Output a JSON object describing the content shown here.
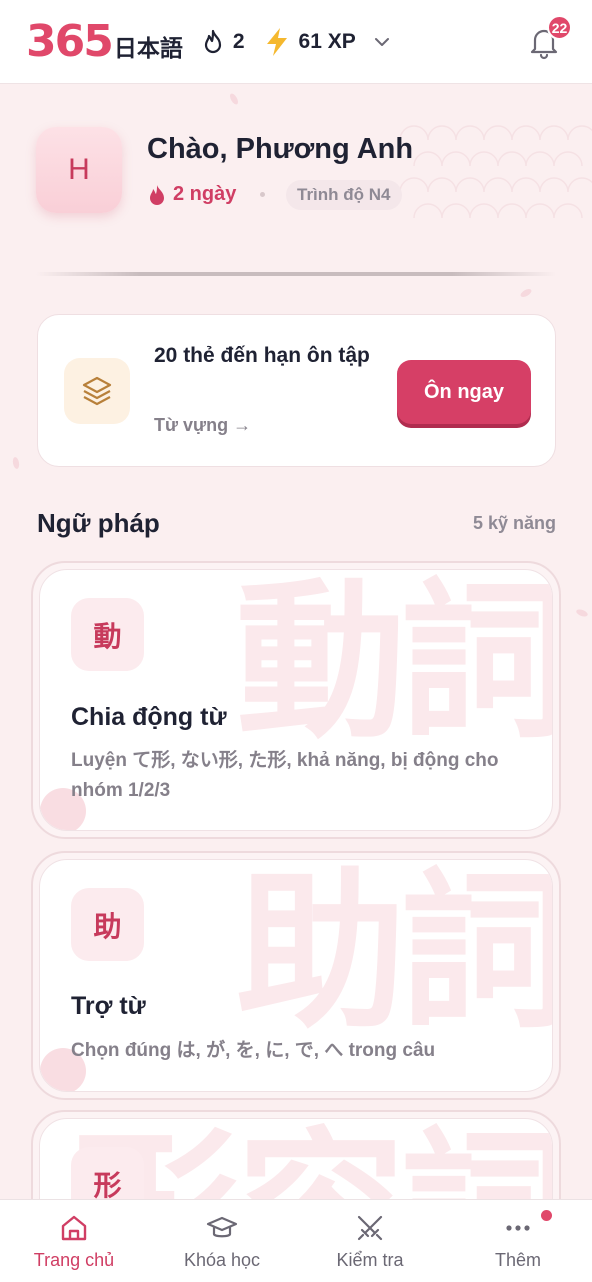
{
  "header": {
    "logo_number": "365",
    "logo_text": "日本語",
    "streak_count": "2",
    "xp_label": "61 XP",
    "notification_count": "22"
  },
  "profile": {
    "avatar_initial": "H",
    "greeting": "Chào, Phương Anh",
    "streak_label": "2 ngày",
    "level_label": "Trình độ N4"
  },
  "review": {
    "title": "20 thẻ đến hạn ôn tập",
    "subtitle": "Từ vựng →",
    "button_label": "Ôn ngay"
  },
  "grammar": {
    "title": "Ngữ pháp",
    "count": "5 kỹ năng",
    "skills": [
      {
        "badge": "動",
        "bg_text": "動詞",
        "title": "Chia động từ",
        "description": "Luyện て形, ない形, た形, khả năng, bị động cho nhóm 1/2/3"
      },
      {
        "badge": "助",
        "bg_text": "助詞",
        "title": "Trợ từ",
        "description": "Chọn đúng は, が, を, に, で, へ trong câu"
      },
      {
        "badge": "形",
        "bg_text": "形容詞",
        "title": "",
        "description": ""
      }
    ]
  },
  "nav": {
    "items": [
      {
        "label": "Trang chủ",
        "icon": "home-icon",
        "active": true
      },
      {
        "label": "Khóa học",
        "icon": "graduation-cap-icon",
        "active": false
      },
      {
        "label": "Kiểm tra",
        "icon": "crossed-swords-icon",
        "active": false
      },
      {
        "label": "Thêm",
        "icon": "more-icon",
        "active": false
      }
    ]
  },
  "colors": {
    "accent": "#d63f66",
    "background": "#fbeff0"
  }
}
